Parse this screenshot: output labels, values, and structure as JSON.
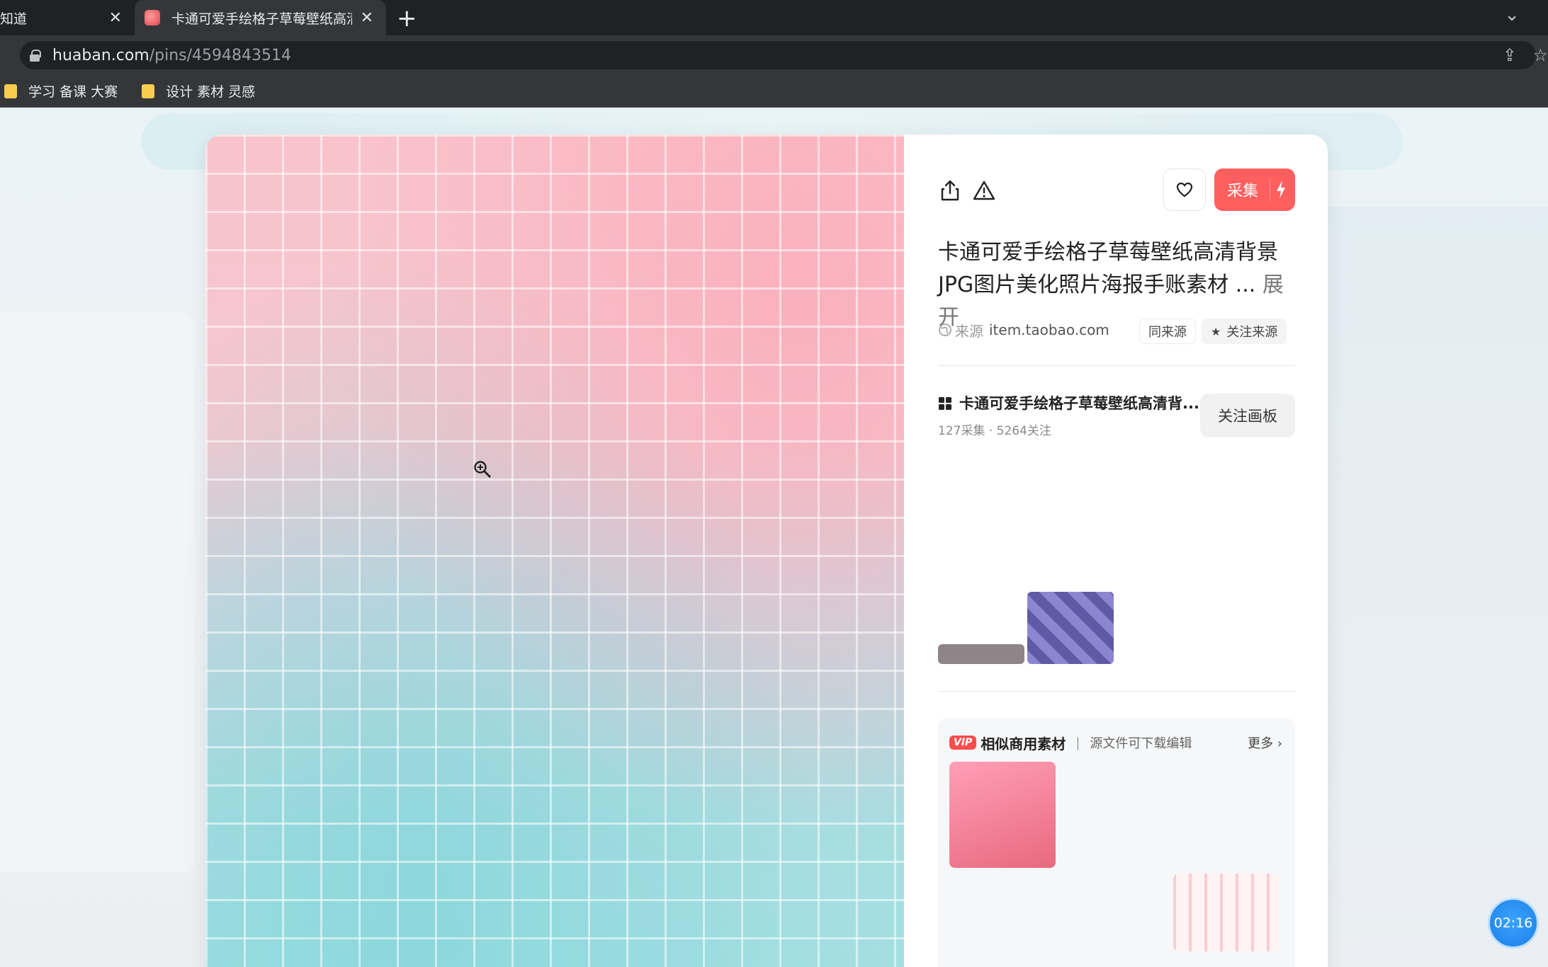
{
  "browser": {
    "tabs": [
      {
        "title": "知道",
        "active": false
      },
      {
        "title": "卡通可爱手绘格子草莓壁纸高清背景",
        "active": true
      }
    ],
    "new_tab_symbol": "+",
    "close_symbol": "✕",
    "url_host": "huaban.com",
    "url_path": "/pins/4594843514",
    "bookmarks": [
      {
        "label": "学习 备课 大赛"
      },
      {
        "label": "设计 素材 灵感"
      }
    ]
  },
  "pin": {
    "collect_label": "采集",
    "title": "卡通可爱手绘格子草莓壁纸高清背景JPG图片美化照片海报手账素材 ...",
    "expand_label": "展开",
    "source_label": "来源",
    "source_domain": "item.taobao.com",
    "same_source_label": "同来源",
    "follow_source_label": "关注来源"
  },
  "board": {
    "title": "卡通可爱手绘格子草莓壁纸高清背...",
    "stats": "127采集 · 5264关注",
    "follow_label": "关注画板"
  },
  "vip": {
    "badge": "VIP",
    "title": "相似商用素材",
    "separator": "|",
    "subtitle": "源文件可下载编辑",
    "more_label": "更多 ›"
  },
  "timer": "02:16",
  "colors": {
    "accent": "#ff5f5f",
    "vip_badge": "#ff4c4c",
    "timer": "#1b7fe6"
  }
}
